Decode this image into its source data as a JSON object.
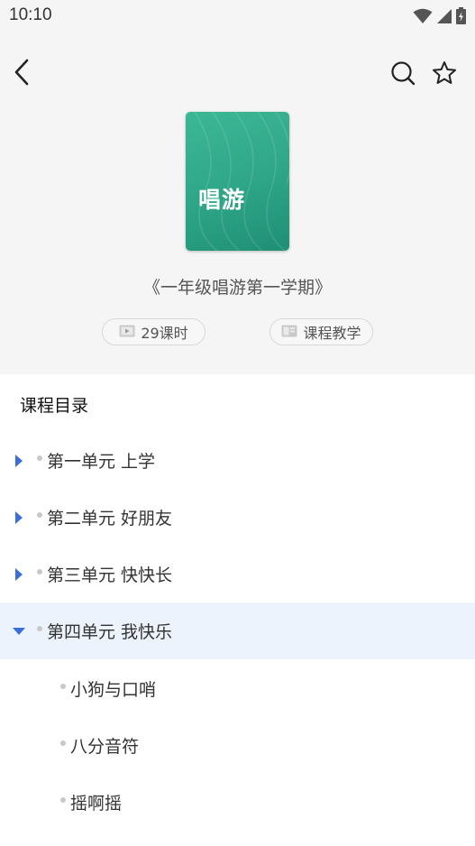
{
  "status_bar": {
    "time": "10:10",
    "icons": [
      "wifi-icon",
      "signal-icon",
      "battery-icon"
    ]
  },
  "nav": {
    "back_icon": "chevron-left-icon",
    "search_icon": "search-icon",
    "favorite_icon": "star-outline-icon"
  },
  "cover": {
    "title": "唱游",
    "color": "#2ea587"
  },
  "course": {
    "name": "《一年级唱游第一学期》",
    "lessons_chip": "29课时",
    "lessons_icon": "video-icon",
    "type_chip": "课程教学",
    "type_icon": "image-card-icon"
  },
  "catalog": {
    "title": "课程目录",
    "accent_color": "#3a6fd8",
    "units": [
      {
        "label": "第一单元 上学",
        "expanded": false
      },
      {
        "label": "第二单元 好朋友",
        "expanded": false
      },
      {
        "label": "第三单元 快快长",
        "expanded": false
      },
      {
        "label": "第四单元 我快乐",
        "expanded": true
      }
    ],
    "lessons": [
      {
        "label": "小狗与口哨"
      },
      {
        "label": "八分音符"
      },
      {
        "label": "摇啊摇"
      }
    ]
  }
}
